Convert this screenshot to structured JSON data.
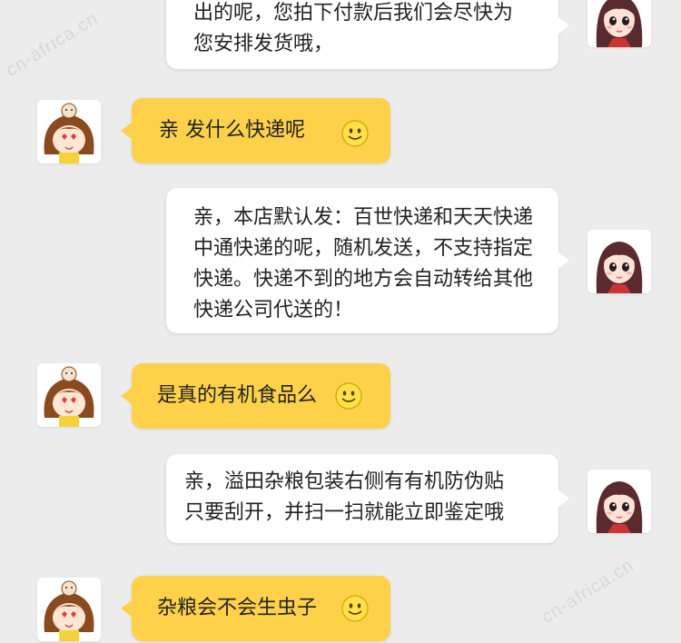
{
  "watermark_text": "cn-africa.cn",
  "messages": [
    {
      "role": "seller",
      "lines": [
        "出的呢，您拍下付款后我们会尽快为",
        "您安排发货哦，"
      ]
    },
    {
      "role": "buyer",
      "text": "亲  发什么快递呢",
      "emoji": "smiley-icon"
    },
    {
      "role": "seller",
      "lines": [
        "亲，本店默认发：百世快递和天天快递",
        "中通快递的呢，随机发送，不支持指定",
        "快递。快递不到的地方会自动转给其他",
        "快递公司代送的！"
      ]
    },
    {
      "role": "buyer",
      "text": "是真的有机食品么",
      "emoji": "smiley-icon"
    },
    {
      "role": "seller",
      "lines": [
        "亲，溢田杂粮包装右侧有有机防伪贴",
        "只要刮开，并扫一扫就能立即鉴定哦"
      ]
    },
    {
      "role": "buyer",
      "text": "杂粮会不会生虫子",
      "emoji": "smiley-icon"
    }
  ],
  "colors": {
    "background": "#ececec",
    "buyer_bubble": "#fdd14a",
    "seller_bubble": "#ffffff"
  }
}
